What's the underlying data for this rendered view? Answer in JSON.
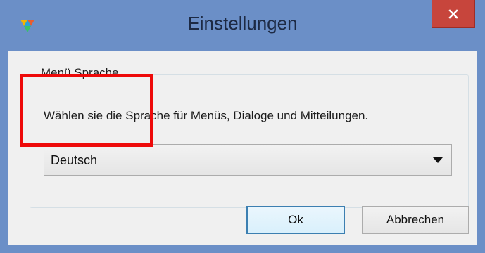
{
  "window": {
    "title": "Einstellungen",
    "close_icon": "close-icon"
  },
  "group": {
    "legend": "Menü Sprache",
    "description": "Wählen sie die Sprache für Menüs, Dialoge und Mitteilungen.",
    "language_select": {
      "selected": "Deutsch"
    }
  },
  "buttons": {
    "ok_label": "Ok",
    "cancel_label": "Abbrechen"
  },
  "colors": {
    "titlebar": "#6b8fc7",
    "close_button": "#c7453c",
    "highlight": "#ee0a0a",
    "ok_border": "#3c7fb1"
  }
}
